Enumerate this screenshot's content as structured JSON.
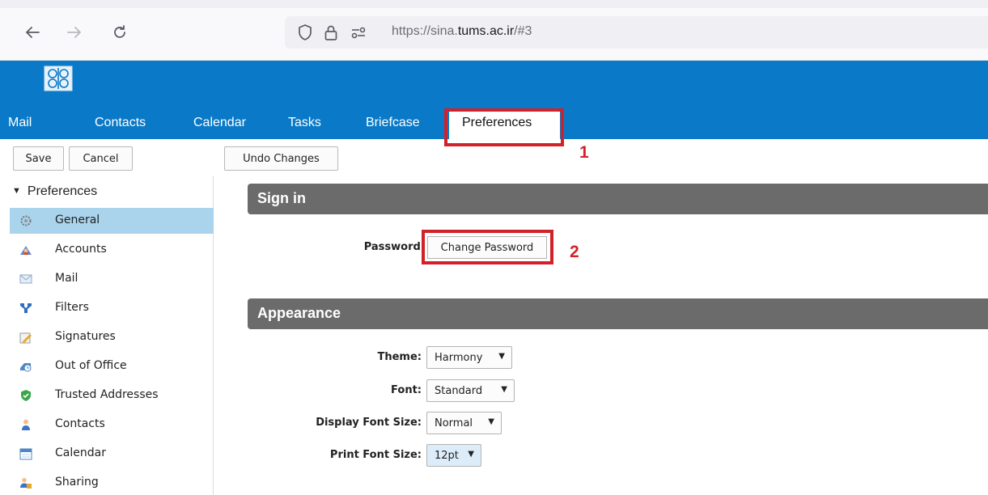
{
  "browser": {
    "url_prefix": "https://sina.",
    "url_domain": "tums.ac.ir",
    "url_suffix": "/#3"
  },
  "app": {
    "tabs": [
      "Mail",
      "Contacts",
      "Calendar",
      "Tasks",
      "Briefcase",
      "Preferences"
    ],
    "active_tab": "Preferences",
    "brand_color": "#0a7ac8"
  },
  "toolbar": {
    "save_label": "Save",
    "cancel_label": "Cancel",
    "undo_label": "Undo Changes"
  },
  "sidebar": {
    "header": "Preferences",
    "items": [
      {
        "label": "General",
        "icon": "gear-icon",
        "selected": true
      },
      {
        "label": "Accounts",
        "icon": "accounts-icon"
      },
      {
        "label": "Mail",
        "icon": "envelope-icon"
      },
      {
        "label": "Filters",
        "icon": "filter-icon"
      },
      {
        "label": "Signatures",
        "icon": "signature-icon"
      },
      {
        "label": "Out of Office",
        "icon": "out-of-office-icon"
      },
      {
        "label": "Trusted Addresses",
        "icon": "shield-check-icon"
      },
      {
        "label": "Contacts",
        "icon": "contact-person-icon"
      },
      {
        "label": "Calendar",
        "icon": "calendar-icon"
      },
      {
        "label": "Sharing",
        "icon": "sharing-icon"
      }
    ]
  },
  "main": {
    "signin": {
      "title": "Sign in",
      "password_label": "Password:",
      "change_password_label": "Change Password"
    },
    "appearance": {
      "title": "Appearance",
      "theme_label": "Theme:",
      "theme_value": "Harmony",
      "font_label": "Font:",
      "font_value": "Standard",
      "display_font_size_label": "Display Font Size:",
      "display_font_size_value": "Normal",
      "print_font_size_label": "Print Font Size:",
      "print_font_size_value": "12pt"
    }
  },
  "annotations": {
    "step1": "1",
    "step2": "2",
    "color": "#d1222b"
  }
}
